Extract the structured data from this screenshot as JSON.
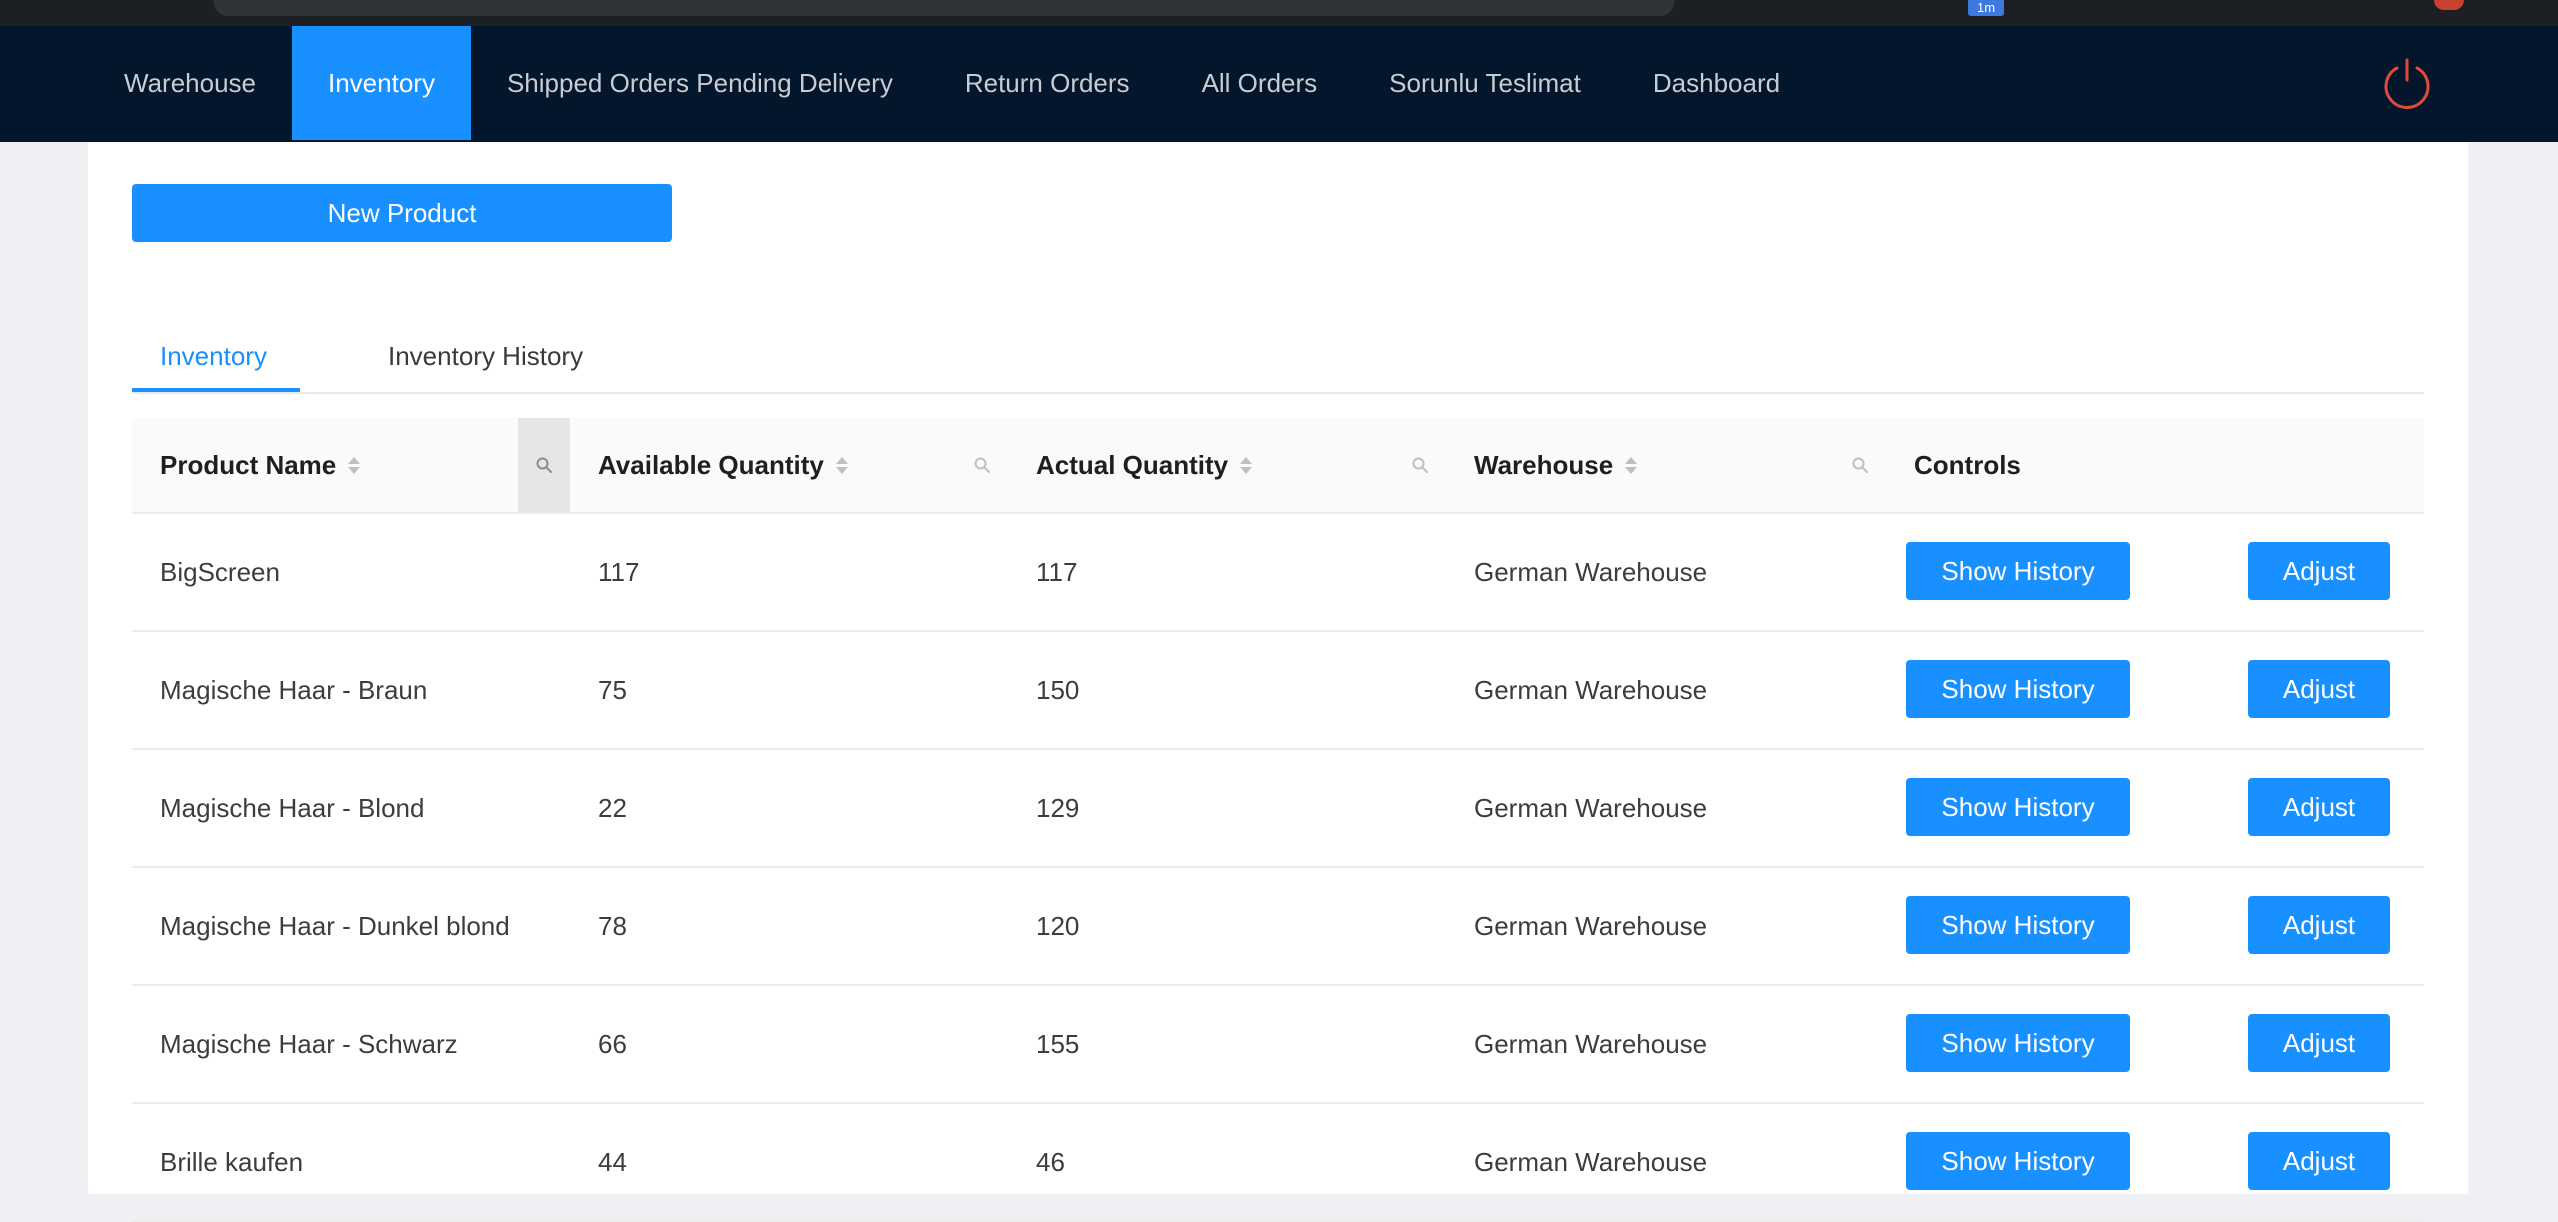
{
  "browser": {
    "badge": "1m"
  },
  "nav": {
    "items": [
      {
        "label": "Warehouse",
        "active": false
      },
      {
        "label": "Inventory",
        "active": true
      },
      {
        "label": "Shipped Orders Pending Delivery",
        "active": false
      },
      {
        "label": "Return Orders",
        "active": false
      },
      {
        "label": "All Orders",
        "active": false
      },
      {
        "label": "Sorunlu Teslimat",
        "active": false
      },
      {
        "label": "Dashboard",
        "active": false
      }
    ],
    "power_icon": "power-icon",
    "power_color": "#e04a3a"
  },
  "toolbar": {
    "new_product_label": "New Product"
  },
  "tabs": [
    {
      "label": "Inventory",
      "active": true
    },
    {
      "label": "Inventory History",
      "active": false
    }
  ],
  "table": {
    "columns": [
      "Product Name",
      "Available Quantity",
      "Actual Quantity",
      "Warehouse",
      "Controls"
    ],
    "rows": [
      {
        "product": "BigScreen",
        "available": "117",
        "actual": "117",
        "warehouse": "German Warehouse"
      },
      {
        "product": "Magische Haar - Braun",
        "available": "75",
        "actual": "150",
        "warehouse": "German Warehouse"
      },
      {
        "product": "Magische Haar - Blond",
        "available": "22",
        "actual": "129",
        "warehouse": "German Warehouse"
      },
      {
        "product": "Magische Haar - Dunkel blond",
        "available": "78",
        "actual": "120",
        "warehouse": "German Warehouse"
      },
      {
        "product": "Magische Haar - Schwarz",
        "available": "66",
        "actual": "155",
        "warehouse": "German Warehouse"
      },
      {
        "product": "Brille kaufen",
        "available": "44",
        "actual": "46",
        "warehouse": "German Warehouse"
      }
    ],
    "show_history_label": "Show History",
    "adjust_label": "Adjust"
  },
  "colors": {
    "accent": "#1890ff",
    "nav_bg": "#04162b"
  }
}
